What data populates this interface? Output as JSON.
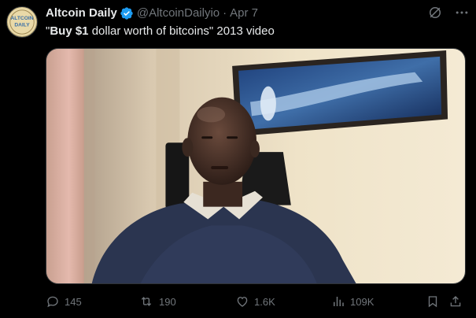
{
  "tweet": {
    "author": {
      "display_name": "Altcoin Daily",
      "handle": "@AltcoinDailyio",
      "separator": "·",
      "date": "Apr 7",
      "verified": true,
      "avatar_text_line1": "ALTCOIN",
      "avatar_text_line2": "DAILY"
    },
    "text": {
      "quote_open": "\"",
      "bold_phrase": "Buy $1",
      "rest": " dollar worth of bitcoins\" 2013 video"
    },
    "media": {
      "type": "video"
    },
    "metrics": {
      "replies": "145",
      "reposts": "190",
      "likes": "1.6K",
      "views": "109K"
    },
    "icons": {
      "reply": "reply-icon",
      "repost": "repost-icon",
      "like": "heart-icon",
      "views": "views-bar-chart-icon",
      "bookmark": "bookmark-icon",
      "share": "share-icon",
      "grok": "grok-icon",
      "more": "more-horizontal-icon"
    },
    "colors": {
      "background": "#000000",
      "primary_text": "#e7e9ea",
      "secondary_text": "#71767b",
      "verified_blue": "#1d9bf0"
    }
  }
}
